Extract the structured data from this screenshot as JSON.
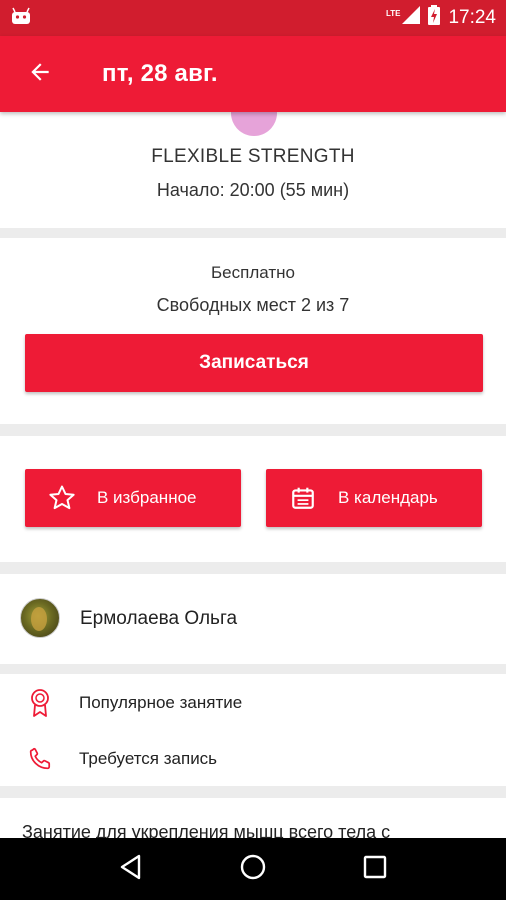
{
  "status_bar": {
    "network": "LTE",
    "time": "17:24"
  },
  "app_bar": {
    "title": "пт, 28 авг."
  },
  "class_info": {
    "name": "FLEXIBLE STRENGTH",
    "start": "Начало: 20:00 (55 мин)"
  },
  "booking": {
    "price": "Бесплатно",
    "slots": "Свободных мест 2 из 7",
    "signup_label": "Записаться"
  },
  "actions": {
    "favorite_label": "В избранное",
    "calendar_label": "В календарь"
  },
  "trainer": {
    "name": "Ермолаева Ольга"
  },
  "features": [
    {
      "icon": "award-icon",
      "label": "Популярное занятие"
    },
    {
      "icon": "phone-icon",
      "label": "Требуется запись"
    }
  ],
  "description": "Занятие для укрепления мышц всего тела с",
  "colors": {
    "accent": "#ee1b36",
    "status_bar": "#d11d2e",
    "divider": "#ececec"
  }
}
